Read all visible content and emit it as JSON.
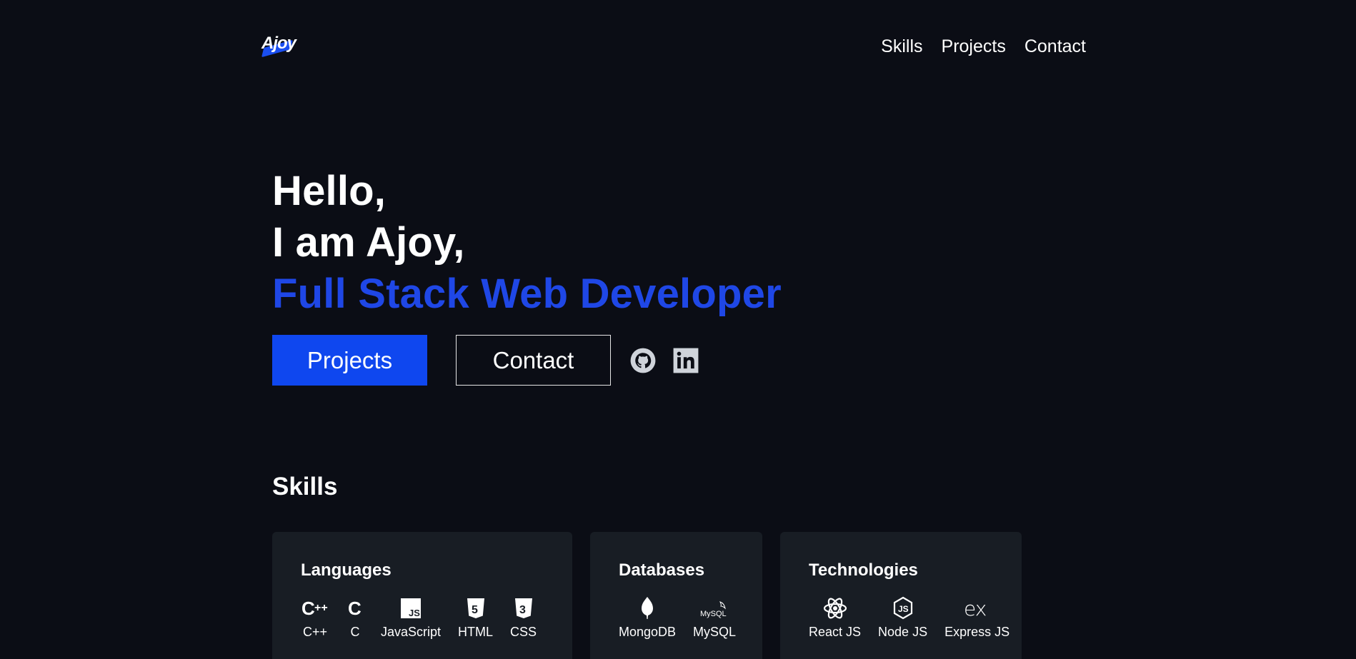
{
  "header": {
    "logo_text": "Ajoy",
    "nav": [
      {
        "label": "Skills"
      },
      {
        "label": "Projects"
      },
      {
        "label": "Contact"
      }
    ]
  },
  "hero": {
    "greeting": "Hello,",
    "intro": "I am Ajoy,",
    "role": "Full Stack Web Developer",
    "primary_button": "Projects",
    "secondary_button": "Contact",
    "social": [
      "github-icon",
      "linkedin-icon"
    ],
    "accent_color": "#1f47e6"
  },
  "skills": {
    "title": "Skills",
    "categories": [
      {
        "title": "Languages",
        "items": [
          {
            "label": "C++",
            "icon": "cplusplus-icon"
          },
          {
            "label": "C",
            "icon": "c-icon"
          },
          {
            "label": "JavaScript",
            "icon": "javascript-icon"
          },
          {
            "label": "HTML",
            "icon": "html5-icon"
          },
          {
            "label": "CSS",
            "icon": "css3-icon"
          }
        ]
      },
      {
        "title": "Databases",
        "items": [
          {
            "label": "MongoDB",
            "icon": "mongodb-icon"
          },
          {
            "label": "MySQL",
            "icon": "mysql-icon"
          }
        ]
      },
      {
        "title": "Technologies",
        "items": [
          {
            "label": "React JS",
            "icon": "react-icon"
          },
          {
            "label": "Node JS",
            "icon": "nodejs-icon"
          },
          {
            "label": "Express JS",
            "icon": "express-icon"
          }
        ]
      }
    ]
  }
}
